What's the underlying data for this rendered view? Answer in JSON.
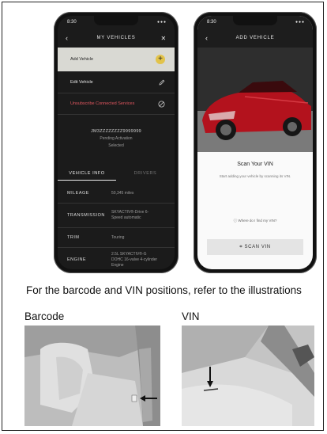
{
  "phone1": {
    "status": {
      "time": "8:30",
      "signal": "●●●"
    },
    "nav": {
      "back": "‹",
      "title": "MY VEHICLES",
      "close": "✕"
    },
    "menu": {
      "add_vehicle": "Add Vehicle",
      "edit_vehicle": "Edit Vehicle",
      "unsubscribe": "Unsubscribe Connected Services"
    },
    "vehicle": {
      "vin": "JM3ZZZZZZZZ9999999",
      "line2": "Pending Activation",
      "line3": "Selected"
    },
    "tabs": {
      "info": "VEHICLE INFO",
      "drivers": "DRIVERS"
    },
    "specs": [
      {
        "key": "MILEAGE",
        "value": "50,345 miles"
      },
      {
        "key": "TRANSMISSION",
        "value": "SKYACTIV®-Drive 6-Speed automatic"
      },
      {
        "key": "TRIM",
        "value": "Touring"
      },
      {
        "key": "ENGINE",
        "value": "2.5L SKYACTIV®-G DOHC 16-valve 4-cylinder Engine"
      }
    ]
  },
  "phone2": {
    "status": {
      "time": "8:30",
      "signal": "●●●"
    },
    "nav": {
      "back": "‹",
      "title": "ADD VEHICLE"
    },
    "scan_title": "Scan Your VIN",
    "scan_subtitle": "Start adding your vehicle by scanning its VIN.",
    "find_vin": "ⓘ Where do I find my VIN?",
    "scan_button": "⌗ SCAN VIN"
  },
  "instruction": "For the barcode and VIN positions, refer to the illustrations",
  "labels": {
    "barcode": "Barcode",
    "vin": "VIN"
  },
  "colors": {
    "accent_yellow": "#e2c34a",
    "unsubscribe_red": "#e0565f",
    "car_red": "#b3121d"
  }
}
